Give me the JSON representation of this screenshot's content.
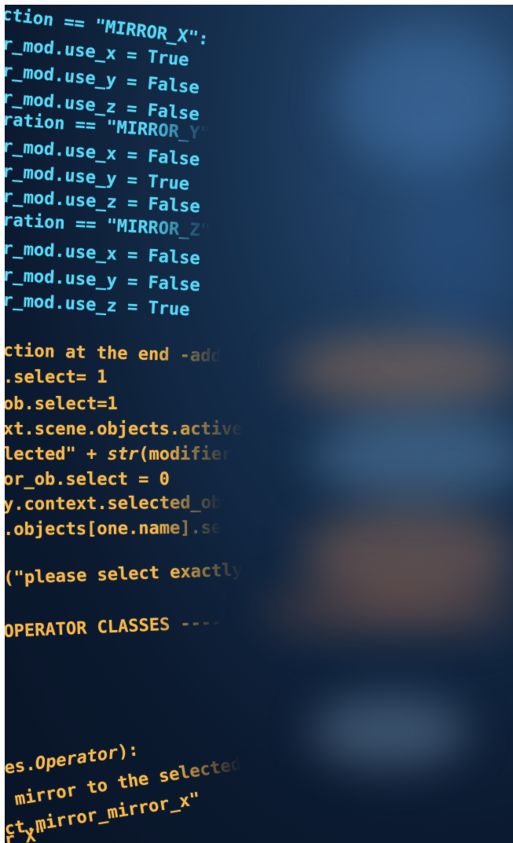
{
  "code_lines": {
    "l1": "ction == \"MIRROR_X\":",
    "l2": "r_mod.use_x = True",
    "l3": "r_mod.use_y = False",
    "l4": "r_mod.use_z = False",
    "l5": "ration == \"MIRROR_Y\"",
    "l6": "r_mod.use_x = False",
    "l7": "r_mod.use_y = True",
    "l8": "r_mod.use_z = False",
    "l9": "ration == \"MIRROR_Z\"",
    "l10": "r_mod.use_x = False",
    "l11": "r_mod.use_y = False",
    "l12": "r_mod.use_z = True",
    "l13": "ction at the end -add",
    "l14": ".select= 1",
    "l15": "ob.select=1",
    "l16": "xt.scene.objects.active",
    "l17a": "lected\" + ",
    "l17b": "str",
    "l17c": "(modifier",
    "l18": "or_ob.select = 0",
    "l19": "y.context.selected_ob",
    "l20": ".objects[one.name].se",
    "l21": "(\"please select exactly",
    "l22": "OPERATOR CLASSES ----",
    "l23a": "es.",
    "l23b": "Operator",
    "l23c": "):",
    "l24": " mirror to the selected",
    "l25": "ct.mirror_mirror_x\"",
    "l26": "r X\""
  },
  "colors": {
    "background": "#0b1a30",
    "cyan": "#56d4f3",
    "orange": "#f3b54a"
  }
}
